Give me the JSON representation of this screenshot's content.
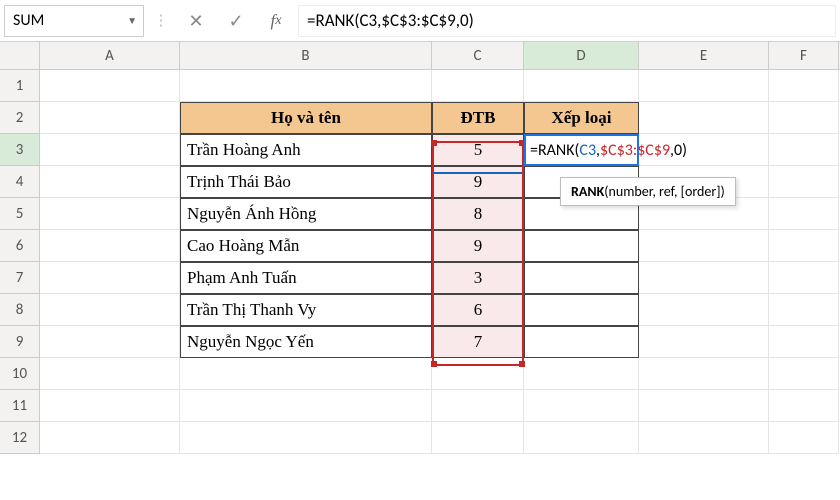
{
  "name_box": "SUM",
  "formula_bar": "=RANK(C3,$C$3:$C$9,0)",
  "columns": [
    "A",
    "B",
    "C",
    "D",
    "E",
    "F"
  ],
  "rows": [
    "1",
    "2",
    "3",
    "4",
    "5",
    "6",
    "7",
    "8",
    "9",
    "10",
    "11",
    "12"
  ],
  "headers": {
    "b": "Họ và tên",
    "c": "ĐTB",
    "d": "Xếp loại"
  },
  "data": [
    {
      "name": "Trần Hoàng Anh",
      "dtb": "5"
    },
    {
      "name": "Trịnh Thái Bảo",
      "dtb": "9"
    },
    {
      "name": "Nguyễn Ánh Hồng",
      "dtb": "8"
    },
    {
      "name": "Cao Hoàng Mẫn",
      "dtb": "9"
    },
    {
      "name": "Phạm Anh Tuấn",
      "dtb": "3"
    },
    {
      "name": "Trần Thị Thanh Vy",
      "dtb": "6"
    },
    {
      "name": "Nguyễn Ngọc Yến",
      "dtb": "7"
    }
  ],
  "editing": {
    "p1": "=RANK(",
    "p2": "C3",
    "p3": ",",
    "p4": "$C$3:$C$9",
    "p5": ",0)"
  },
  "tooltip": {
    "fn": "RANK",
    "sig": "(number, ref, [order])"
  },
  "chart_data": {
    "type": "table",
    "columns": [
      "Họ và tên",
      "ĐTB",
      "Xếp loại"
    ],
    "rows": [
      [
        "Trần Hoàng Anh",
        5,
        null
      ],
      [
        "Trịnh Thái Bảo",
        9,
        null
      ],
      [
        "Nguyễn Ánh Hồng",
        8,
        null
      ],
      [
        "Cao Hoàng Mẫn",
        9,
        null
      ],
      [
        "Phạm Anh Tuấn",
        3,
        null
      ],
      [
        "Trần Thị Thanh Vy",
        6,
        null
      ],
      [
        "Nguyễn Ngọc Yến",
        7,
        null
      ]
    ]
  }
}
